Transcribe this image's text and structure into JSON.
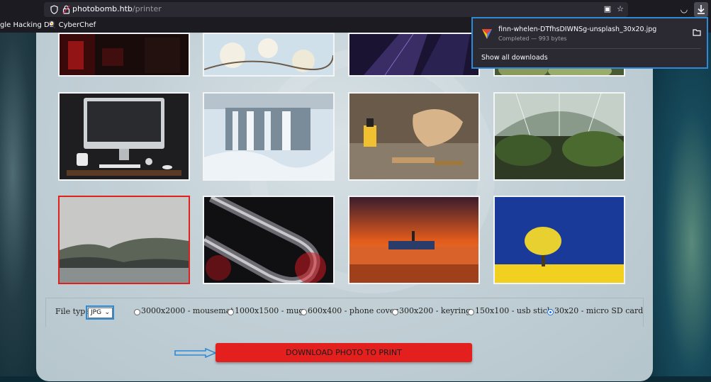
{
  "browser": {
    "url_host": "photobomb.htb",
    "url_path": "/printer",
    "bookmarks": [
      "gle Hacking DB",
      "CyberChef"
    ]
  },
  "downloads_panel": {
    "file_name": "finn-whelen-DTfhsDIWNSg-unsplash_30x20.jpg",
    "status": "Completed — 993 bytes",
    "show_all": "Show all downloads"
  },
  "photos": [
    {
      "name": "red-lights"
    },
    {
      "name": "white-blossoms"
    },
    {
      "name": "skyscraper-night"
    },
    {
      "name": "green-plants"
    },
    {
      "name": "desktop-computer"
    },
    {
      "name": "frozen-waterfall"
    },
    {
      "name": "wood-workshop"
    },
    {
      "name": "glass-greenhouse"
    },
    {
      "name": "misty-coastline",
      "selected": true
    },
    {
      "name": "chrome-paperclip"
    },
    {
      "name": "boat-sunset"
    },
    {
      "name": "yellow-tree"
    }
  ],
  "form": {
    "file_type_label": "File type",
    "file_type_value": "JPG",
    "dimensions": [
      "3000x2000 - mousemat",
      "1000x1500 - mug",
      "600x400 - phone cover",
      "300x200 - keyring",
      "150x100 - usb stick",
      "30x20 - micro SD card"
    ],
    "selected_dimension": "30x20 - micro SD card",
    "download_button": "DOWNLOAD PHOTO TO PRINT"
  },
  "colors": {
    "accent_red": "#e4201f",
    "annotation_blue": "#2f8ad6"
  }
}
